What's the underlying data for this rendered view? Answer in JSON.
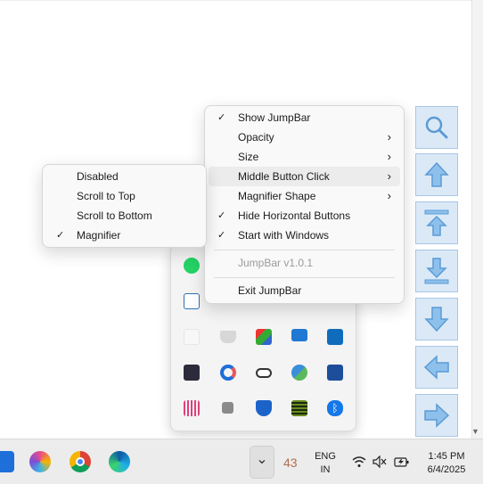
{
  "context_menu": {
    "items": [
      {
        "label": "Show JumpBar",
        "checked": true,
        "submenu": false
      },
      {
        "label": "Opacity",
        "checked": false,
        "submenu": true
      },
      {
        "label": "Size",
        "checked": false,
        "submenu": true
      },
      {
        "label": "Middle Button Click",
        "checked": false,
        "submenu": true,
        "highlighted": true
      },
      {
        "label": "Magnifier Shape",
        "checked": false,
        "submenu": true
      },
      {
        "label": "Hide Horizontal Buttons",
        "checked": true,
        "submenu": false
      },
      {
        "label": "Start with Windows",
        "checked": true,
        "submenu": false
      }
    ],
    "version_label": "JumpBar v1.0.1",
    "exit_label": "Exit JumpBar",
    "check_glyph": "✓",
    "submenu_glyph": "›"
  },
  "middle_click_submenu": {
    "items": [
      {
        "label": "Disabled",
        "checked": false
      },
      {
        "label": "Scroll to Top",
        "checked": false
      },
      {
        "label": "Scroll to Bottom",
        "checked": false
      },
      {
        "label": "Magnifier",
        "checked": true
      }
    ]
  },
  "jumpbar": {
    "buttons": [
      "magnifier-icon",
      "arrow-up-icon",
      "scroll-to-top-icon",
      "scroll-to-bottom-icon",
      "arrow-down-icon",
      "arrow-left-icon",
      "arrow-right-icon"
    ],
    "accent": "#5b9bd5",
    "fill": "#dbe9f7"
  },
  "tray_flyout": {
    "icons": [
      "whatsapp-icon",
      "network-share-icon",
      "blank-icon",
      "coffee-cup-icon",
      "color-app-icon",
      "monitor-icon",
      "outlook-icon",
      "grid-app-icon",
      "refresh-app-icon",
      "onedrive-icon",
      "sync-app-icon",
      "azure-icon",
      "audio-wave-icon",
      "gray-square-icon",
      "defender-icon",
      "keyboard-app-icon",
      "bluetooth-icon"
    ]
  },
  "taskbar": {
    "apps": [
      "app-icon",
      "paint-icon",
      "chrome-icon",
      "edge-icon"
    ],
    "overflow_glyph": "⌄",
    "count": "43",
    "lang_line1": "ENG",
    "lang_line2": "IN",
    "time": "1:45 PM",
    "date": "6/4/2025"
  }
}
